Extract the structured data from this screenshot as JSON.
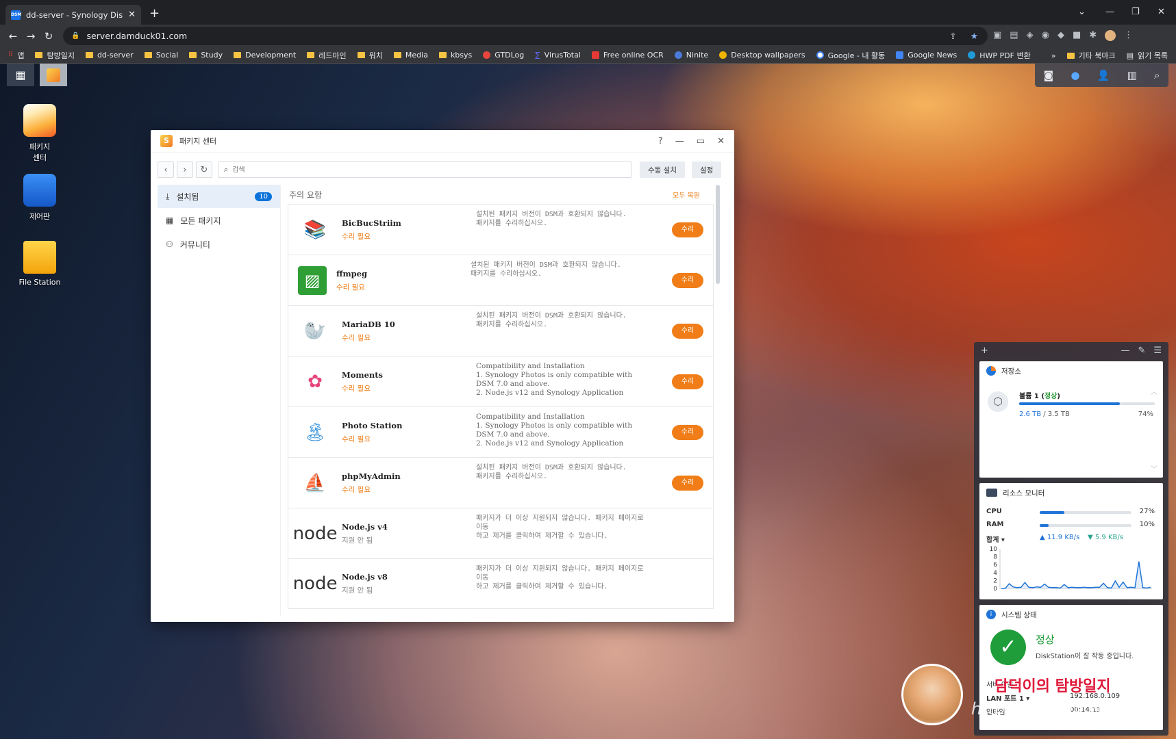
{
  "browser": {
    "tab_title": "dd-server - Synology DiskStation",
    "tab_favicon": "DSM",
    "url": "server.damduck01.com",
    "bookmarks": [
      "앱",
      "탐방일지",
      "dd-server",
      "Social",
      "Study",
      "Development",
      "레드마인",
      "워치",
      "Media",
      "kbsys",
      "GTDLog",
      "VirusTotal",
      "Free online OCR",
      "Ninite",
      "Desktop wallpapers",
      "Google - 내 활동",
      "Google News",
      "HWP PDF 변환"
    ],
    "bookmarks_more": "»",
    "bookmarks_other": "기타 북마크",
    "reading_list": "읽기 목록"
  },
  "desktop": {
    "icons": [
      {
        "label": "패키지 센터"
      },
      {
        "label": "제어판"
      },
      {
        "label": "File Station"
      }
    ]
  },
  "package_center": {
    "title": "패키지 센터",
    "search_placeholder": "검색",
    "manual_install": "수동 설치",
    "settings": "설정",
    "sidebar": [
      {
        "label": "설치됨",
        "badge": "10"
      },
      {
        "label": "모든 패키지"
      },
      {
        "label": "커뮤니티"
      }
    ],
    "section_title": "주의 요함",
    "restore_all": "모두 복원",
    "packages": [
      {
        "name": "BicBucStriim",
        "status": "수리 필요",
        "desc": "설치된 패키지 버전이 DSM과 호환되지 않습니다.\n패키지를 수리하십시오.",
        "action": "수리",
        "icon": "books-icon"
      },
      {
        "name": "ffmpeg",
        "status": "수리 필요",
        "desc": "설치된 패키지 버전이 DSM과 호환되지 않습니다.\n패키지를 수리하십시오.",
        "action": "수리",
        "icon": "ffmpeg-icon"
      },
      {
        "name": "MariaDB 10",
        "status": "수리 필요",
        "desc": "설치된 패키지 버전이 DSM과 호환되지 않습니다.\n패키지를 수리하십시오.",
        "action": "수리",
        "icon": "seal-icon"
      },
      {
        "name": "Moments",
        "status": "수리 필요",
        "desc": "Compatibility and Installation\n  1. Synology Photos is only compatible with\n     DSM 7.0 and above.\n  2. Node.js v12 and Synology Application",
        "action": "수리",
        "icon": "flower-icon"
      },
      {
        "name": "Photo Station",
        "status": "수리 필요",
        "desc": "Compatibility and Installation\n  1. Synology Photos is only compatible with\n     DSM 7.0 and above.\n  2. Node.js v12 and Synology Application",
        "action": "수리",
        "icon": "photo-icon"
      },
      {
        "name": "phpMyAdmin",
        "status": "수리 필요",
        "desc": "설치된 패키지 버전이 DSM과 호환되지 않습니다.\n패키지를 수리하십시오.",
        "action": "수리",
        "icon": "sailboat-icon"
      },
      {
        "name": "Node.js v4",
        "status": "지원 안 됨",
        "desc": "패키지가 더 이상 지원되지 않습니다. 패키지 페이지로 이동\n하고 제거를 클릭하여 제거할 수 있습니다.",
        "action": "",
        "icon": "nodejs-icon"
      },
      {
        "name": "Node.js v8",
        "status": "지원 안 됨",
        "desc": "패키지가 더 이상 지원되지 않습니다. 패키지 페이지로 이동\n하고 제거를 클릭하여 제거할 수 있습니다.",
        "action": "",
        "icon": "nodejs-icon"
      }
    ]
  },
  "widgets": {
    "storage": {
      "title": "저장소",
      "volume_name": "볼륨 1",
      "volume_status": "정상",
      "used": "2.6 TB",
      "total": "3.5 TB",
      "percent_label": "74%",
      "percent": 74
    },
    "resource_monitor": {
      "title": "리소스 모니터",
      "cpu_label": "CPU",
      "cpu_pct_label": "27%",
      "cpu_pct": 27,
      "ram_label": "RAM",
      "ram_pct_label": "10%",
      "ram_pct": 10,
      "net_label": "합계",
      "upload": "11.9 KB/s",
      "download": "5.9 KB/s",
      "chart_data": {
        "type": "line",
        "yticks": [
          10,
          8,
          6,
          4,
          2,
          0
        ],
        "ylim": [
          0,
          10
        ],
        "values": [
          0,
          0,
          1.2,
          0.4,
          0.2,
          0.3,
          1.5,
          0.3,
          0.2,
          0.4,
          0.3,
          1.1,
          0.3,
          0.2,
          0.2,
          0.1,
          1.0,
          0.2,
          0.3,
          0.2,
          0.2,
          0.3,
          0.2,
          0.2,
          0.3,
          0.3,
          1.3,
          0.2,
          0.1,
          1.9,
          0.3,
          1.6,
          0.2,
          0.3,
          0.2,
          6.8,
          0.2,
          0.1,
          0.3
        ]
      }
    },
    "system_status": {
      "title": "시스템 상태",
      "status": "정상",
      "message": "DiskStation이 잘 작동 중입니다.",
      "server_label": "서버 이름",
      "lan_label": "LAN 포트 1",
      "lan_value": "192.168.0.109",
      "uptime_label": "업타임",
      "uptime_value": "00:14:13"
    }
  },
  "watermark": {
    "title": "담덕이의 탐방일지",
    "url": "http://damduck01.com"
  }
}
